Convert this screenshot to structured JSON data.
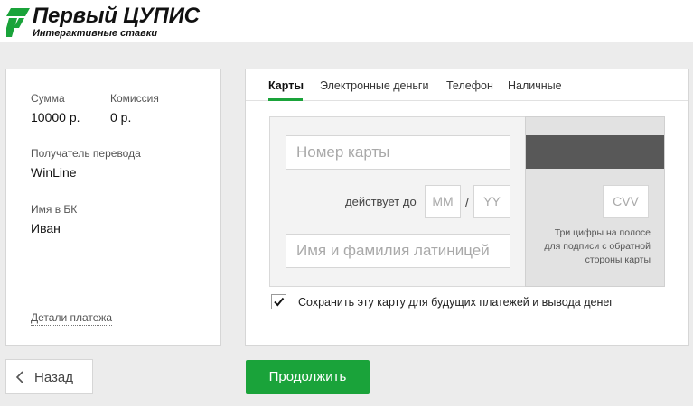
{
  "header": {
    "brand_title": "Первый ЦУПИС",
    "brand_subtitle": "Интерактивные ставки",
    "brand_color": "#1aa33a"
  },
  "summary": {
    "amount_label": "Сумма",
    "amount_value": "10000 р.",
    "fee_label": "Комиссия",
    "fee_value": "0 р.",
    "recipient_label": "Получатель перевода",
    "recipient_value": "WinLine",
    "name_label": "Имя в БК",
    "name_value": "Иван",
    "details_link": "Детали платежа"
  },
  "payment": {
    "tabs": [
      {
        "label": "Карты",
        "active": true
      },
      {
        "label": "Электронные деньги",
        "active": false
      },
      {
        "label": "Телефон",
        "active": false
      },
      {
        "label": "Наличные",
        "active": false
      }
    ],
    "card_number_placeholder": "Номер  карты",
    "valid_label": "действует до",
    "month_placeholder": "ММ",
    "slash": "/",
    "year_placeholder": "YY",
    "holder_placeholder": "Имя и фамилия латиницей",
    "cvv_placeholder": "CVV",
    "cvv_hint_lines": [
      "Три цифры на полосе",
      "для подписи с обратной",
      "стороны карты"
    ],
    "save_card_checked": true,
    "save_card_label": "Сохранить эту карту для будущих платежей и вывода денег"
  },
  "buttons": {
    "back_label": "Назад",
    "back_icon": "chevron-left-icon",
    "continue_label": "Продолжить",
    "continue_color": "#1aa33a"
  }
}
